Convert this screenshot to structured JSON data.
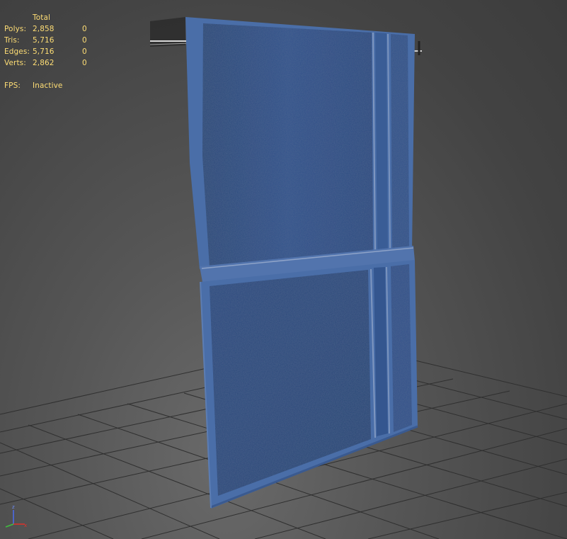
{
  "stats": {
    "header_total": "Total",
    "rows": [
      {
        "label": "Polys:",
        "total": "2,858",
        "selected": "0"
      },
      {
        "label": "Tris:",
        "total": "5,716",
        "selected": "0"
      },
      {
        "label": "Edges:",
        "total": "5,716",
        "selected": "0"
      },
      {
        "label": "Verts:",
        "total": "2,862",
        "selected": "0"
      }
    ],
    "fps_label": "FPS:",
    "fps_value": "Inactive"
  },
  "gizmo": {
    "z_label": "z",
    "x_label": "x",
    "colors": {
      "x": "#e0312b",
      "y": "#3fbf3f",
      "z": "#4a6cf0"
    }
  },
  "colors": {
    "stats_text": "#ffde75",
    "towel_main": "#2d4e86",
    "towel_border": "#4a6ea8",
    "grid_line": "#2e2e2e"
  }
}
